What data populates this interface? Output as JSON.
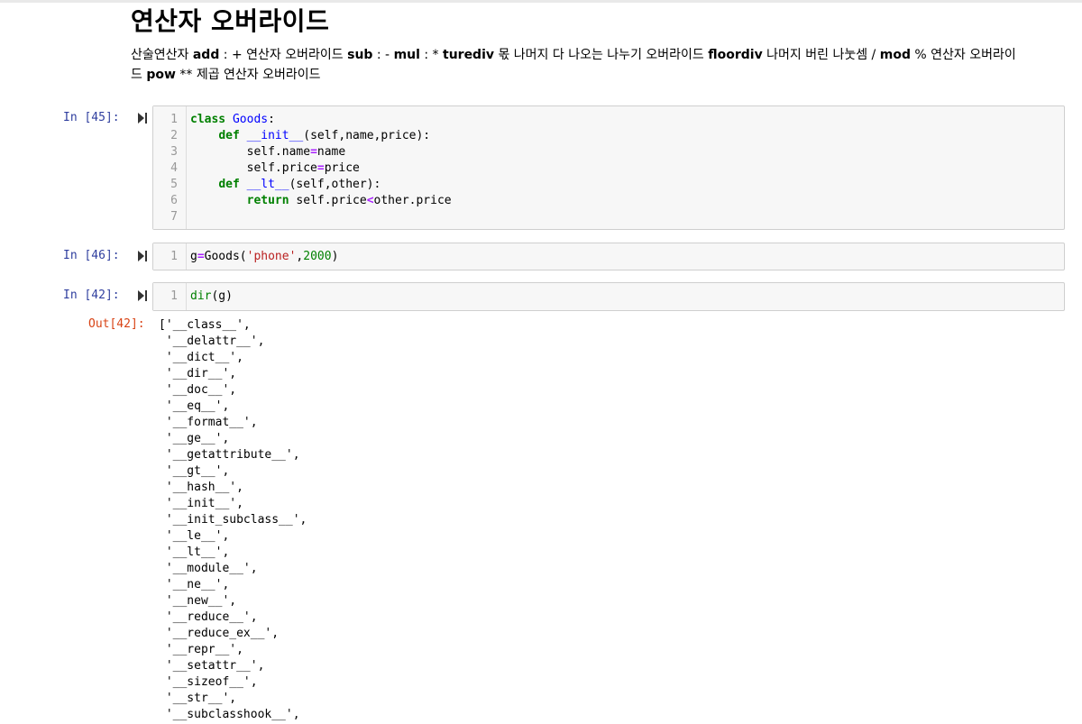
{
  "markdown": {
    "heading": "연산자 오버라이드",
    "para_line1": [
      {
        "t": "산술연산자 "
      },
      {
        "t": "add",
        "b": true
      },
      {
        "t": " : + 연산자 오버라이드 "
      },
      {
        "t": "sub",
        "b": true
      },
      {
        "t": " : - "
      },
      {
        "t": "mul",
        "b": true
      },
      {
        "t": " : * "
      },
      {
        "t": "turediv",
        "b": true
      },
      {
        "t": " 몫 나머지 다 나오는 나누기 오버라이드 "
      },
      {
        "t": "floordiv",
        "b": true
      },
      {
        "t": " 나머지 버린 나눗셈 / "
      },
      {
        "t": "mod",
        "b": true
      },
      {
        "t": " % 연산자 오버라이"
      }
    ],
    "para_line2": [
      {
        "t": "드 "
      },
      {
        "t": "pow",
        "b": true
      },
      {
        "t": " ** 제곱 연산자 오버라이드"
      }
    ]
  },
  "cells": [
    {
      "prompt": "In [45]:",
      "lines": [
        {
          "n": "1",
          "tokens": [
            {
              "t": "class",
              "c": "kw"
            },
            {
              "t": " "
            },
            {
              "t": "Goods",
              "c": "cls"
            },
            {
              "t": ":"
            }
          ]
        },
        {
          "n": "2",
          "tokens": [
            {
              "t": "    "
            },
            {
              "t": "def",
              "c": "kw"
            },
            {
              "t": " "
            },
            {
              "t": "__init__",
              "c": "fn"
            },
            {
              "t": "(self,name,price):"
            }
          ]
        },
        {
          "n": "3",
          "tokens": [
            {
              "t": "        self.name"
            },
            {
              "t": "=",
              "c": "op"
            },
            {
              "t": "name"
            }
          ]
        },
        {
          "n": "4",
          "tokens": [
            {
              "t": "        self.price"
            },
            {
              "t": "=",
              "c": "op"
            },
            {
              "t": "price"
            }
          ]
        },
        {
          "n": "5",
          "tokens": [
            {
              "t": "    "
            },
            {
              "t": "def",
              "c": "kw"
            },
            {
              "t": " "
            },
            {
              "t": "__lt__",
              "c": "fn"
            },
            {
              "t": "(self,other):"
            }
          ]
        },
        {
          "n": "6",
          "tokens": [
            {
              "t": "        "
            },
            {
              "t": "return",
              "c": "kw"
            },
            {
              "t": " self.price"
            },
            {
              "t": "<",
              "c": "op"
            },
            {
              "t": "other.price"
            }
          ]
        },
        {
          "n": "7",
          "tokens": []
        }
      ]
    },
    {
      "prompt": "In [46]:",
      "lines": [
        {
          "n": "1",
          "tokens": [
            {
              "t": "g"
            },
            {
              "t": "=",
              "c": "op"
            },
            {
              "t": "Goods("
            },
            {
              "t": "'phone'",
              "c": "str"
            },
            {
              "t": ","
            },
            {
              "t": "2000",
              "c": "num"
            },
            {
              "t": ")"
            }
          ]
        }
      ]
    },
    {
      "prompt": "In [42]:",
      "lines": [
        {
          "n": "1",
          "tokens": [
            {
              "t": "dir",
              "c": "kw2"
            },
            {
              "t": "(g)"
            }
          ]
        }
      ]
    }
  ],
  "output": {
    "prompt": "Out[42]:",
    "lines": [
      "['__class__',",
      " '__delattr__',",
      " '__dict__',",
      " '__dir__',",
      " '__doc__',",
      " '__eq__',",
      " '__format__',",
      " '__ge__',",
      " '__getattribute__',",
      " '__gt__',",
      " '__hash__',",
      " '__init__',",
      " '__init_subclass__',",
      " '__le__',",
      " '__lt__',",
      " '__module__',",
      " '__ne__',",
      " '__new__',",
      " '__reduce__',",
      " '__reduce_ex__',",
      " '__repr__',",
      " '__setattr__',",
      " '__sizeof__',",
      " '__str__',",
      " '__subclasshook__',"
    ]
  },
  "colors": {
    "prompt_in": "#303f9f",
    "prompt_out": "#d84315",
    "keyword": "#008000",
    "builtin_name": "#0000ff",
    "operator": "#aa22ff",
    "string": "#ba2121"
  },
  "icons": {
    "run": "run-cell-icon"
  }
}
